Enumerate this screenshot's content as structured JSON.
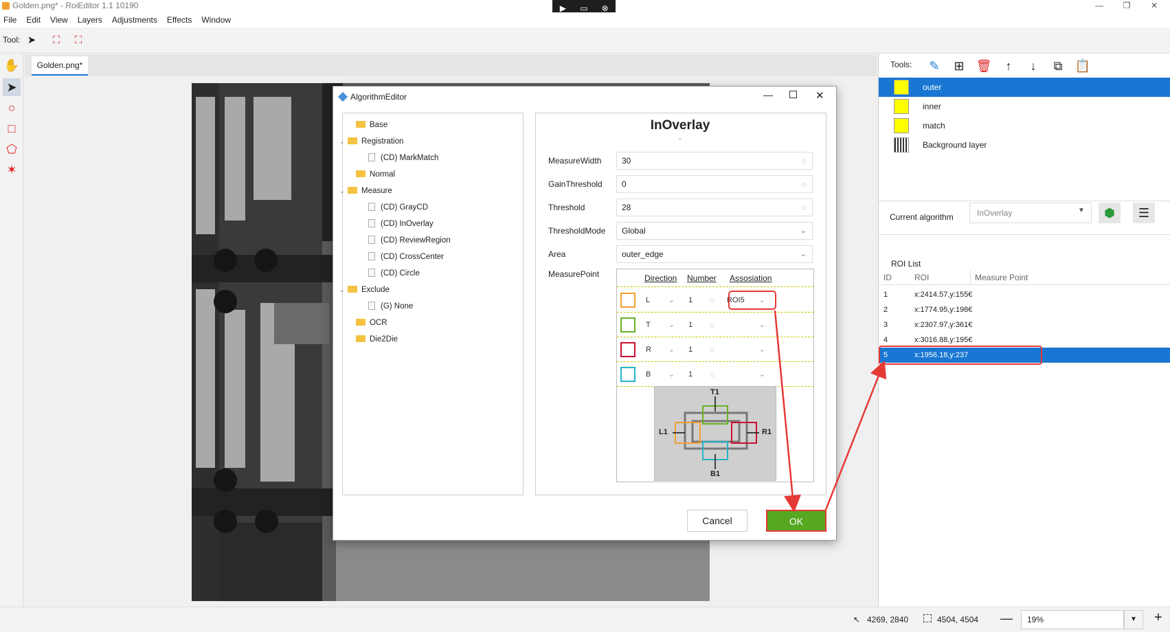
{
  "window": {
    "title": "Golden.png* - RoiEditor 1.1 10190",
    "minimize": "—",
    "restore": "❐",
    "close": "✕"
  },
  "menu": [
    "File",
    "Edit",
    "View",
    "Layers",
    "Adjustments",
    "Effects",
    "Window"
  ],
  "toolbar": {
    "label": "Tool:"
  },
  "document_tab": "Golden.png*",
  "right_panel": {
    "tools_label": "Tools:",
    "layers": [
      {
        "name": "outer",
        "selected": true
      },
      {
        "name": "inner",
        "selected": false
      },
      {
        "name": "match",
        "selected": false
      },
      {
        "name": "Background layer",
        "selected": false
      }
    ],
    "current_algorithm_label": "Current algorithm",
    "current_algorithm_value": "InOverlay",
    "roi_list_label": "ROI List",
    "roi_columns": [
      "ID",
      "ROI",
      "Measure Point"
    ],
    "roi_rows": [
      {
        "id": "1",
        "roi": "x:2414.57,y:155€"
      },
      {
        "id": "2",
        "roi": "x:1774.95,y:198€"
      },
      {
        "id": "3",
        "roi": "x:2307.97,y:361€"
      },
      {
        "id": "4",
        "roi": "x:3016.88,y:195€"
      },
      {
        "id": "5",
        "roi": "x:1956.18,y:237",
        "selected": true
      }
    ]
  },
  "status": {
    "cursor": "4269, 2840",
    "size": "4504, 4504",
    "zoom": "19%",
    "zoom_out": "—",
    "zoom_in": "+"
  },
  "dialog": {
    "title": "AlgorithmEditor",
    "tree": [
      {
        "label": "Base",
        "kind": "folder",
        "level": 0
      },
      {
        "label": "Registration",
        "kind": "folder",
        "level": 0,
        "expanded": true
      },
      {
        "label": "(CD) MarkMatch",
        "kind": "file",
        "level": 1
      },
      {
        "label": "Normal",
        "kind": "folder",
        "level": 0
      },
      {
        "label": "Measure",
        "kind": "folder",
        "level": 0,
        "expanded": true
      },
      {
        "label": "(CD) GrayCD",
        "kind": "file",
        "level": 1
      },
      {
        "label": "(CD) InOverlay",
        "kind": "file",
        "level": 1
      },
      {
        "label": "(CD) ReviewRegion",
        "kind": "file",
        "level": 1
      },
      {
        "label": "(CD) CrossCenter",
        "kind": "file",
        "level": 1
      },
      {
        "label": "(CD) Circle",
        "kind": "file",
        "level": 1
      },
      {
        "label": "Exclude",
        "kind": "folder",
        "level": 0,
        "expanded": true
      },
      {
        "label": "(G) None",
        "kind": "file",
        "level": 1
      },
      {
        "label": "OCR",
        "kind": "folder",
        "level": 0
      },
      {
        "label": "Die2Die",
        "kind": "folder",
        "level": 0
      }
    ],
    "heading": "InOverlay",
    "props": [
      {
        "label": "MeasureWidth",
        "value": "30",
        "type": "spin"
      },
      {
        "label": "GainThreshold",
        "value": "0",
        "type": "spin"
      },
      {
        "label": "Threshold",
        "value": "28",
        "type": "spin"
      },
      {
        "label": "ThresholdMode",
        "value": "Global",
        "type": "combo"
      },
      {
        "label": "Area",
        "value": "outer_edge",
        "type": "combo"
      }
    ],
    "measure_point_label": "MeasurePoint",
    "mp_headers": [
      "Direction",
      "Number",
      "Assosiation"
    ],
    "mp_rows": [
      {
        "color": "#f0a030",
        "direction": "L",
        "number": "1",
        "association": "ROI5"
      },
      {
        "color": "#6ab023",
        "direction": "T",
        "number": "1",
        "association": ""
      },
      {
        "color": "#c8102e",
        "direction": "R",
        "number": "1",
        "association": ""
      },
      {
        "color": "#27b3c5",
        "direction": "B",
        "number": "1",
        "association": ""
      }
    ],
    "diagram_labels": {
      "top": "T1",
      "left": "L1",
      "right": "R1",
      "bottom": "B1"
    },
    "cancel": "Cancel",
    "ok": "OK"
  },
  "colors": {
    "accent": "#1976d2",
    "highlight": "#e53935",
    "ok_green": "#55a820"
  }
}
